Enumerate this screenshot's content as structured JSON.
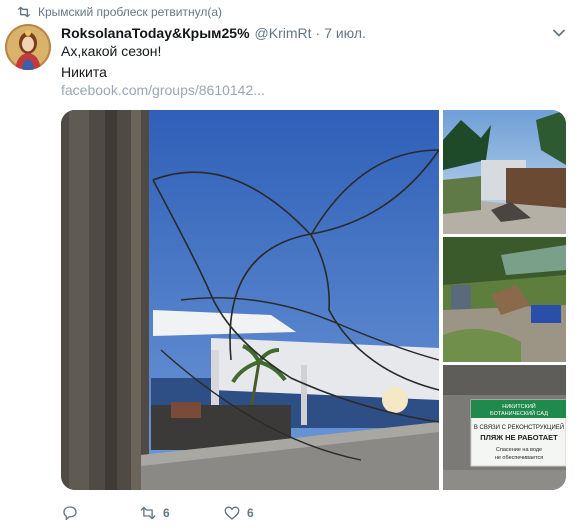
{
  "retweet": {
    "text": "Крымский проблеск ретвитнул(а)"
  },
  "tweet": {
    "display_name": "RoksolanaToday&Крым25%",
    "handle": "@KrimRt",
    "separator": "·",
    "date": "7 июл.",
    "lines": [
      "Ах,какой сезон!",
      "Никита"
    ],
    "link": "facebook.com/groups/8610142..."
  },
  "sign": {
    "org_line1": "НИКИТСКИЙ",
    "org_line2": "БОТАНИЧЕСКИЙ САД",
    "line1": "В СВЯЗИ С РЕКОНСТРУКЦИЕЙ",
    "line2": "ПЛЯЖ НЕ РАБОТАЕТ",
    "line3": "Спасение на воде",
    "line4": "не обеспечивается"
  },
  "actions": {
    "reply_count": "",
    "retweet_count": "6",
    "like_count": "6"
  },
  "colors": {
    "secondary_text": "#657786",
    "link": "#9aa7b3",
    "sign_green": "#1f8a4c"
  }
}
